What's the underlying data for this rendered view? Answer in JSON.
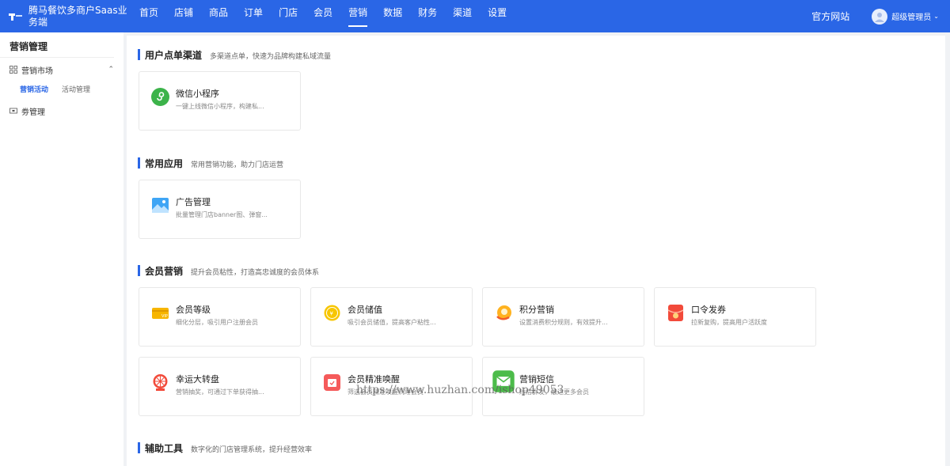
{
  "header": {
    "brand_title": "腾马餐饮多商户Saas业务端",
    "nav": [
      "首页",
      "店铺",
      "商品",
      "订单",
      "门店",
      "会员",
      "营销",
      "数据",
      "财务",
      "渠道",
      "设置"
    ],
    "active_nav": "营销",
    "site_link": "官方网站",
    "user_name": "超级管理员"
  },
  "sidebar": {
    "title": "营销管理",
    "group_market": "营销市场",
    "sub_items": [
      "营销活动",
      "活动管理"
    ],
    "group_coupon": "劵管理"
  },
  "sections": {
    "channel": {
      "title": "用户点单渠道",
      "desc": "多渠道点单，快速为品牌构建私域流量"
    },
    "common": {
      "title": "常用应用",
      "desc": "常用营销功能，助力门店运营"
    },
    "member": {
      "title": "会员营销",
      "desc": "提升会员粘性，打造高忠诚度的会员体系"
    },
    "tools": {
      "title": "辅助工具",
      "desc": "数字化的门店管理系统，提升经营效率"
    }
  },
  "cards": {
    "wechat": {
      "title": "微信小程序",
      "desc": "一键上线微信小程序，构建私..."
    },
    "ads": {
      "title": "广告管理",
      "desc": "批量管理门店banner图、弹窗..."
    },
    "level": {
      "title": "会员等级",
      "desc": "细化分层，吸引用户注册会员"
    },
    "stored": {
      "title": "会员储值",
      "desc": "吸引会员储值，提高客户粘性..."
    },
    "points": {
      "title": "积分营销",
      "desc": "设置消费积分规则，有效提升..."
    },
    "password": {
      "title": "口令发券",
      "desc": "拉新复购，提高用户活跃度"
    },
    "wheel": {
      "title": "幸运大转盘",
      "desc": "营销抽奖，可通过下单获得抽..."
    },
    "wakeup": {
      "title": "会员精准唤醒",
      "desc": "筛选会员精准唤醒沉睡会员"
    },
    "sms": {
      "title": "营销短信",
      "desc": "短信群发，触达更多会员"
    }
  },
  "watermark": "https://www.huzhan.com/ishop49053",
  "colors": {
    "primary": "#2a66e6",
    "background": "#f0f2f5"
  }
}
